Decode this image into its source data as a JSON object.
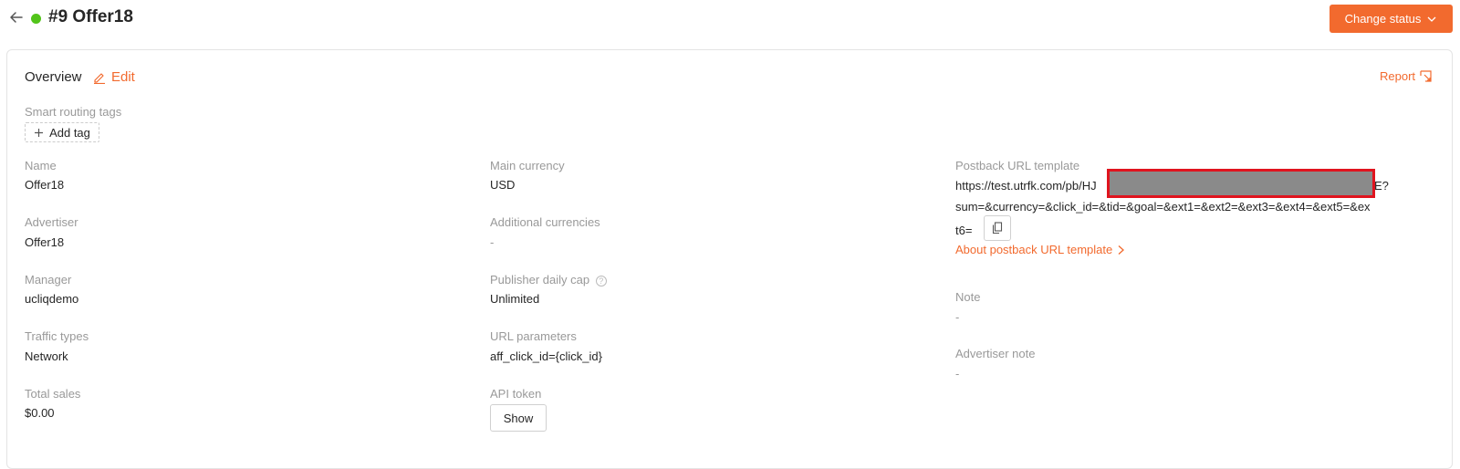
{
  "header": {
    "title": "#9 Offer18",
    "change_status_label": "Change status",
    "status_color": "#52c41a"
  },
  "overview": {
    "title": "Overview",
    "edit_label": "Edit",
    "report_label": "Report"
  },
  "tags": {
    "label": "Smart routing tags",
    "add_tag_label": "Add tag"
  },
  "col1": {
    "name_label": "Name",
    "name_value": "Offer18",
    "advertiser_label": "Advertiser",
    "advertiser_value": "Offer18",
    "manager_label": "Manager",
    "manager_value": "ucliqdemo",
    "traffic_label": "Traffic types",
    "traffic_value": "Network",
    "sales_label": "Total sales",
    "sales_value": "$0.00"
  },
  "col2": {
    "currency_label": "Main currency",
    "currency_value": "USD",
    "additional_label": "Additional currencies",
    "additional_value": "-",
    "cap_label": "Publisher daily cap",
    "cap_value": "Unlimited",
    "url_params_label": "URL parameters",
    "url_params_value": "aff_click_id={click_id}",
    "api_label": "API token",
    "api_show_label": "Show"
  },
  "col3": {
    "postback_label": "Postback URL template",
    "postback_line1_start": "https://test.utrfk.com/pb/HJ",
    "postback_line1_end": "E?",
    "postback_line2": "sum=&currency=&click_id=&tid=&goal=&ext1=&ext2=&ext3=&ext4=&ext5=&ex",
    "postback_line3": "t6=",
    "about_label": "About postback URL template",
    "note_label": "Note",
    "note_value": "-",
    "adv_note_label": "Advertiser note",
    "adv_note_value": "-"
  },
  "colors": {
    "accent": "#f26a2e",
    "redaction_border": "#e0141e",
    "redaction_fill": "#8a8a8a"
  },
  "icons": {
    "back": "arrow-left-icon",
    "edit": "pencil-icon",
    "report": "external-link-icon",
    "add": "plus-icon",
    "copy": "copy-icon",
    "chevron": "chevron-down-icon",
    "help": "question-circle-icon"
  }
}
